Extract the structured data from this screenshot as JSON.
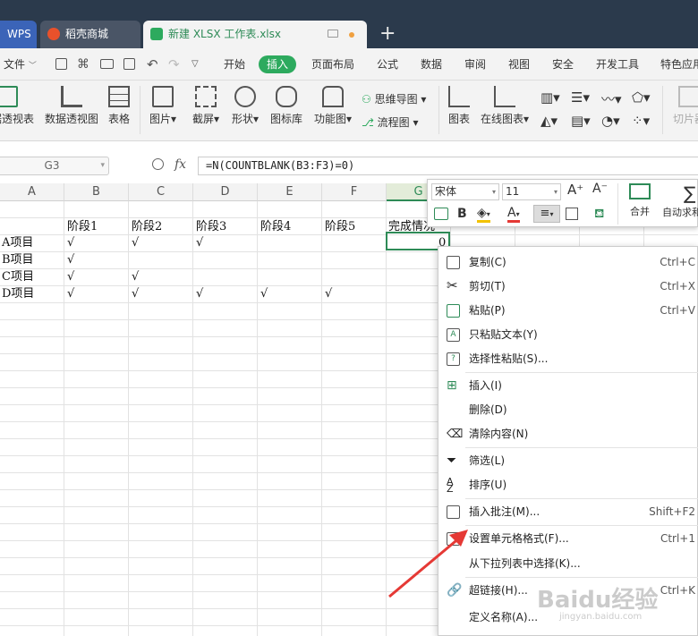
{
  "tabs": [
    {
      "label": "WPS"
    },
    {
      "label": "稻壳商城"
    },
    {
      "label": "新建 XLSX 工作表.xlsx"
    }
  ],
  "tab_new": "+",
  "menu": {
    "file": "文件",
    "items": [
      "开始",
      "插入",
      "页面布局",
      "公式",
      "数据",
      "审阅",
      "视图",
      "安全",
      "开发工具",
      "特色应用"
    ]
  },
  "ribbon": {
    "pivot_table": "数据透视表",
    "pivot_chart": "数据透视图",
    "table": "表格",
    "picture": "图片",
    "screenshot": "截屏",
    "shape": "形状",
    "icon_lib": "图标库",
    "func_chart": "功能图",
    "mindmap": "思维导图",
    "flowchart": "流程图",
    "chart": "图表",
    "online_chart": "在线图表",
    "slice": "切片器"
  },
  "formula_bar": {
    "name_box": "G3",
    "fx": "fx",
    "formula": "=N(COUNTBLANK(B3:F3)=0)"
  },
  "columns": [
    "A",
    "B",
    "C",
    "D",
    "E",
    "F",
    "G"
  ],
  "sheet": {
    "headers": [
      "阶段1",
      "阶段2",
      "阶段3",
      "阶段4",
      "阶段5",
      "完成情况"
    ],
    "rows": [
      {
        "name": "A项目",
        "b": "√",
        "c": "√",
        "d": "√",
        "e": "",
        "f": "",
        "g": "0"
      },
      {
        "name": "B项目",
        "b": "√",
        "c": "",
        "d": "",
        "e": "",
        "f": "",
        "g": ""
      },
      {
        "name": "C项目",
        "b": "√",
        "c": "√",
        "d": "",
        "e": "",
        "f": "",
        "g": ""
      },
      {
        "name": "D项目",
        "b": "√",
        "c": "√",
        "d": "√",
        "e": "√",
        "f": "√",
        "g": ""
      }
    ]
  },
  "mini_toolbar": {
    "font": "宋体",
    "size": "11",
    "merge": "合并",
    "autosum": "自动求和"
  },
  "context_menu": [
    {
      "label": "复制(C)",
      "shortcut": "Ctrl+C",
      "icon": "copy-icon"
    },
    {
      "label": "剪切(T)",
      "shortcut": "Ctrl+X",
      "icon": "scissors-icon"
    },
    {
      "label": "粘贴(P)",
      "shortcut": "Ctrl+V",
      "icon": "paste-icon"
    },
    {
      "label": "只粘贴文本(Y)",
      "shortcut": "",
      "icon": "paste-text-icon"
    },
    {
      "label": "选择性粘贴(S)...",
      "shortcut": "",
      "icon": "paste-special-icon"
    },
    {
      "label": "插入(I)",
      "shortcut": "",
      "icon": "insert-icon"
    },
    {
      "label": "删除(D)",
      "shortcut": "",
      "icon": ""
    },
    {
      "label": "清除内容(N)",
      "shortcut": "",
      "icon": "eraser-icon"
    },
    {
      "label": "筛选(L)",
      "shortcut": "",
      "icon": "filter-icon"
    },
    {
      "label": "排序(U)",
      "shortcut": "",
      "icon": "sort-icon"
    },
    {
      "label": "插入批注(M)...",
      "shortcut": "Shift+F2",
      "icon": "comment-icon"
    },
    {
      "label": "设置单元格格式(F)...",
      "shortcut": "Ctrl+1",
      "icon": "format-cells-icon"
    },
    {
      "label": "从下拉列表中选择(K)...",
      "shortcut": "",
      "icon": ""
    },
    {
      "label": "超链接(H)...",
      "shortcut": "Ctrl+K",
      "icon": "link-icon"
    },
    {
      "label": "定义名称(A)...",
      "shortcut": "",
      "icon": ""
    }
  ],
  "watermark": {
    "brand": "Baidu经验",
    "url": "jingyan.baidu.com"
  },
  "colors": {
    "accent": "#2daa5e",
    "tabbar": "#2b3a4c",
    "arrow": "#e53935"
  }
}
